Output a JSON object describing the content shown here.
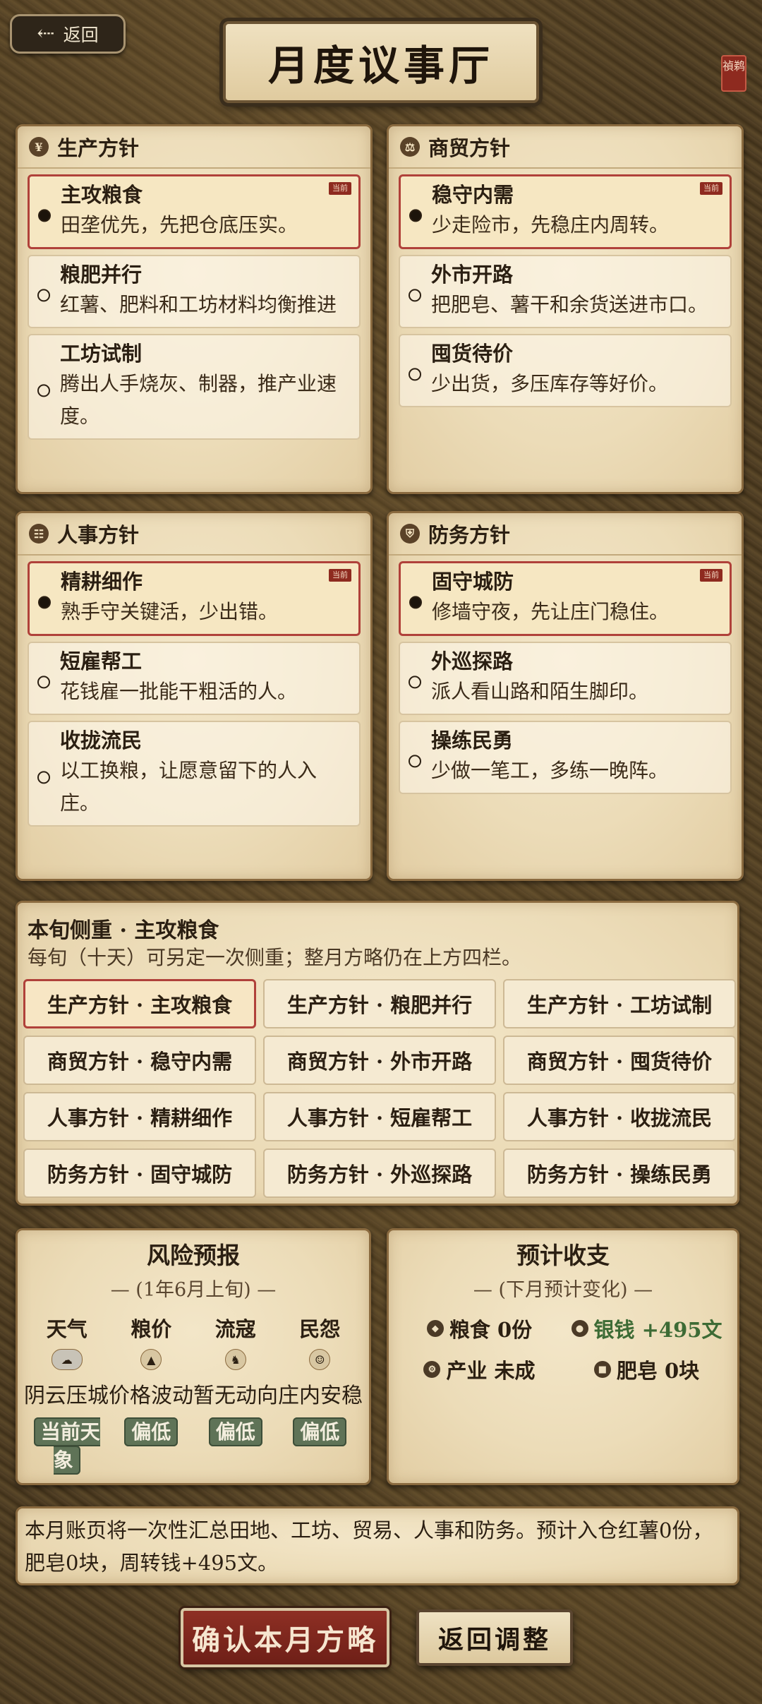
{
  "header": {
    "back_label": "返回",
    "back_icon": "arrow-left-icon",
    "title": "月度议事厅",
    "seal_text": "禎鹈"
  },
  "panels": [
    {
      "title": "生产方针",
      "icon": "wheat-icon",
      "options": [
        {
          "name": "主攻粮食",
          "desc": "田垄优先，先把仓底压实。",
          "selected": true,
          "tag": "当前"
        },
        {
          "name": "粮肥并行",
          "desc": "红薯、肥料和工坊材料均衡推进",
          "selected": false
        },
        {
          "name": "工坊试制",
          "desc": "腾出人手烧灰、制器，推产业速度。",
          "selected": false
        }
      ]
    },
    {
      "title": "商贸方针",
      "icon": "scale-icon",
      "options": [
        {
          "name": "稳守内需",
          "desc": "少走险市，先稳庄内周转。",
          "selected": true,
          "tag": "当前"
        },
        {
          "name": "外市开路",
          "desc": "把肥皂、薯干和余货送进市口。",
          "selected": false
        },
        {
          "name": "囤货待价",
          "desc": "少出货，多压库存等好价。",
          "selected": false
        }
      ]
    },
    {
      "title": "人事方针",
      "icon": "people-icon",
      "options": [
        {
          "name": "精耕细作",
          "desc": "熟手守关键活，少出错。",
          "selected": true,
          "tag": "当前"
        },
        {
          "name": "短雇帮工",
          "desc": "花钱雇一批能干粗活的人。",
          "selected": false
        },
        {
          "name": "收拢流民",
          "desc": "以工换粮，让愿意留下的人入庄。",
          "selected": false
        }
      ]
    },
    {
      "title": "防务方针",
      "icon": "shield-icon",
      "options": [
        {
          "name": "固守城防",
          "desc": "修墙守夜，先让庄门稳住。",
          "selected": true,
          "tag": "当前"
        },
        {
          "name": "外巡探路",
          "desc": "派人看山路和陌生脚印。",
          "selected": false
        },
        {
          "name": "操练民勇",
          "desc": "少做一笔工，多练一晚阵。",
          "selected": false
        }
      ]
    }
  ],
  "focus": {
    "title": "本旬侧重 · 主攻粮食",
    "subtitle": "每旬（十天）可另定一次侧重；整月方略仍在上方四栏。",
    "options": [
      {
        "label": "生产方针 · 主攻粮食",
        "selected": true
      },
      {
        "label": "生产方针 · 粮肥并行",
        "selected": false
      },
      {
        "label": "生产方针 · 工坊试制",
        "selected": false
      },
      {
        "label": "商贸方针 · 稳守内需",
        "selected": false
      },
      {
        "label": "商贸方针 · 外市开路",
        "selected": false
      },
      {
        "label": "商贸方针 · 囤货待价",
        "selected": false
      },
      {
        "label": "人事方针 · 精耕细作",
        "selected": false
      },
      {
        "label": "人事方针 · 短雇帮工",
        "selected": false
      },
      {
        "label": "人事方针 · 收拢流民",
        "selected": false
      },
      {
        "label": "防务方针 · 固守城防",
        "selected": false
      },
      {
        "label": "防务方针 · 外巡探路",
        "selected": false
      },
      {
        "label": "防务方针 · 操练民勇",
        "selected": false
      }
    ]
  },
  "risk": {
    "title": "风险预报",
    "subtitle": "— (1年6月上旬) —",
    "items": [
      {
        "label": "天气",
        "icon": "cloud-icon",
        "text": "阴云压城",
        "badge": "当前天象"
      },
      {
        "label": "粮价",
        "icon": "grain-sack-icon",
        "text": "价格波动",
        "badge": "偏低"
      },
      {
        "label": "流寇",
        "icon": "bandit-icon",
        "text": "暂无动向",
        "badge": "偏低"
      },
      {
        "label": "民怨",
        "icon": "face-icon",
        "text": "庄内安稳",
        "badge": "偏低"
      }
    ]
  },
  "budget": {
    "title": "预计收支",
    "subtitle": "— (下月预计变化) —",
    "items": [
      {
        "icon": "grain-icon",
        "text": "粮食 0份",
        "positive": false
      },
      {
        "icon": "coin-icon",
        "text": "银钱 +495文",
        "positive": true
      },
      {
        "icon": "industry-icon",
        "text": "产业 未成",
        "positive": false
      },
      {
        "icon": "soap-icon",
        "text": "肥皂 0块",
        "positive": false
      }
    ]
  },
  "summary": "本月账页将一次性汇总田地、工坊、贸易、人事和防务。预计入仓红薯0份，肥皂0块，周转钱+495文。",
  "actions": {
    "confirm_label": "确认本月方略",
    "adjust_label": "返回调整"
  },
  "colors": {
    "accent_red": "#b0413a",
    "badge_green": "#5f7357",
    "positive_green": "#3d6b35"
  }
}
